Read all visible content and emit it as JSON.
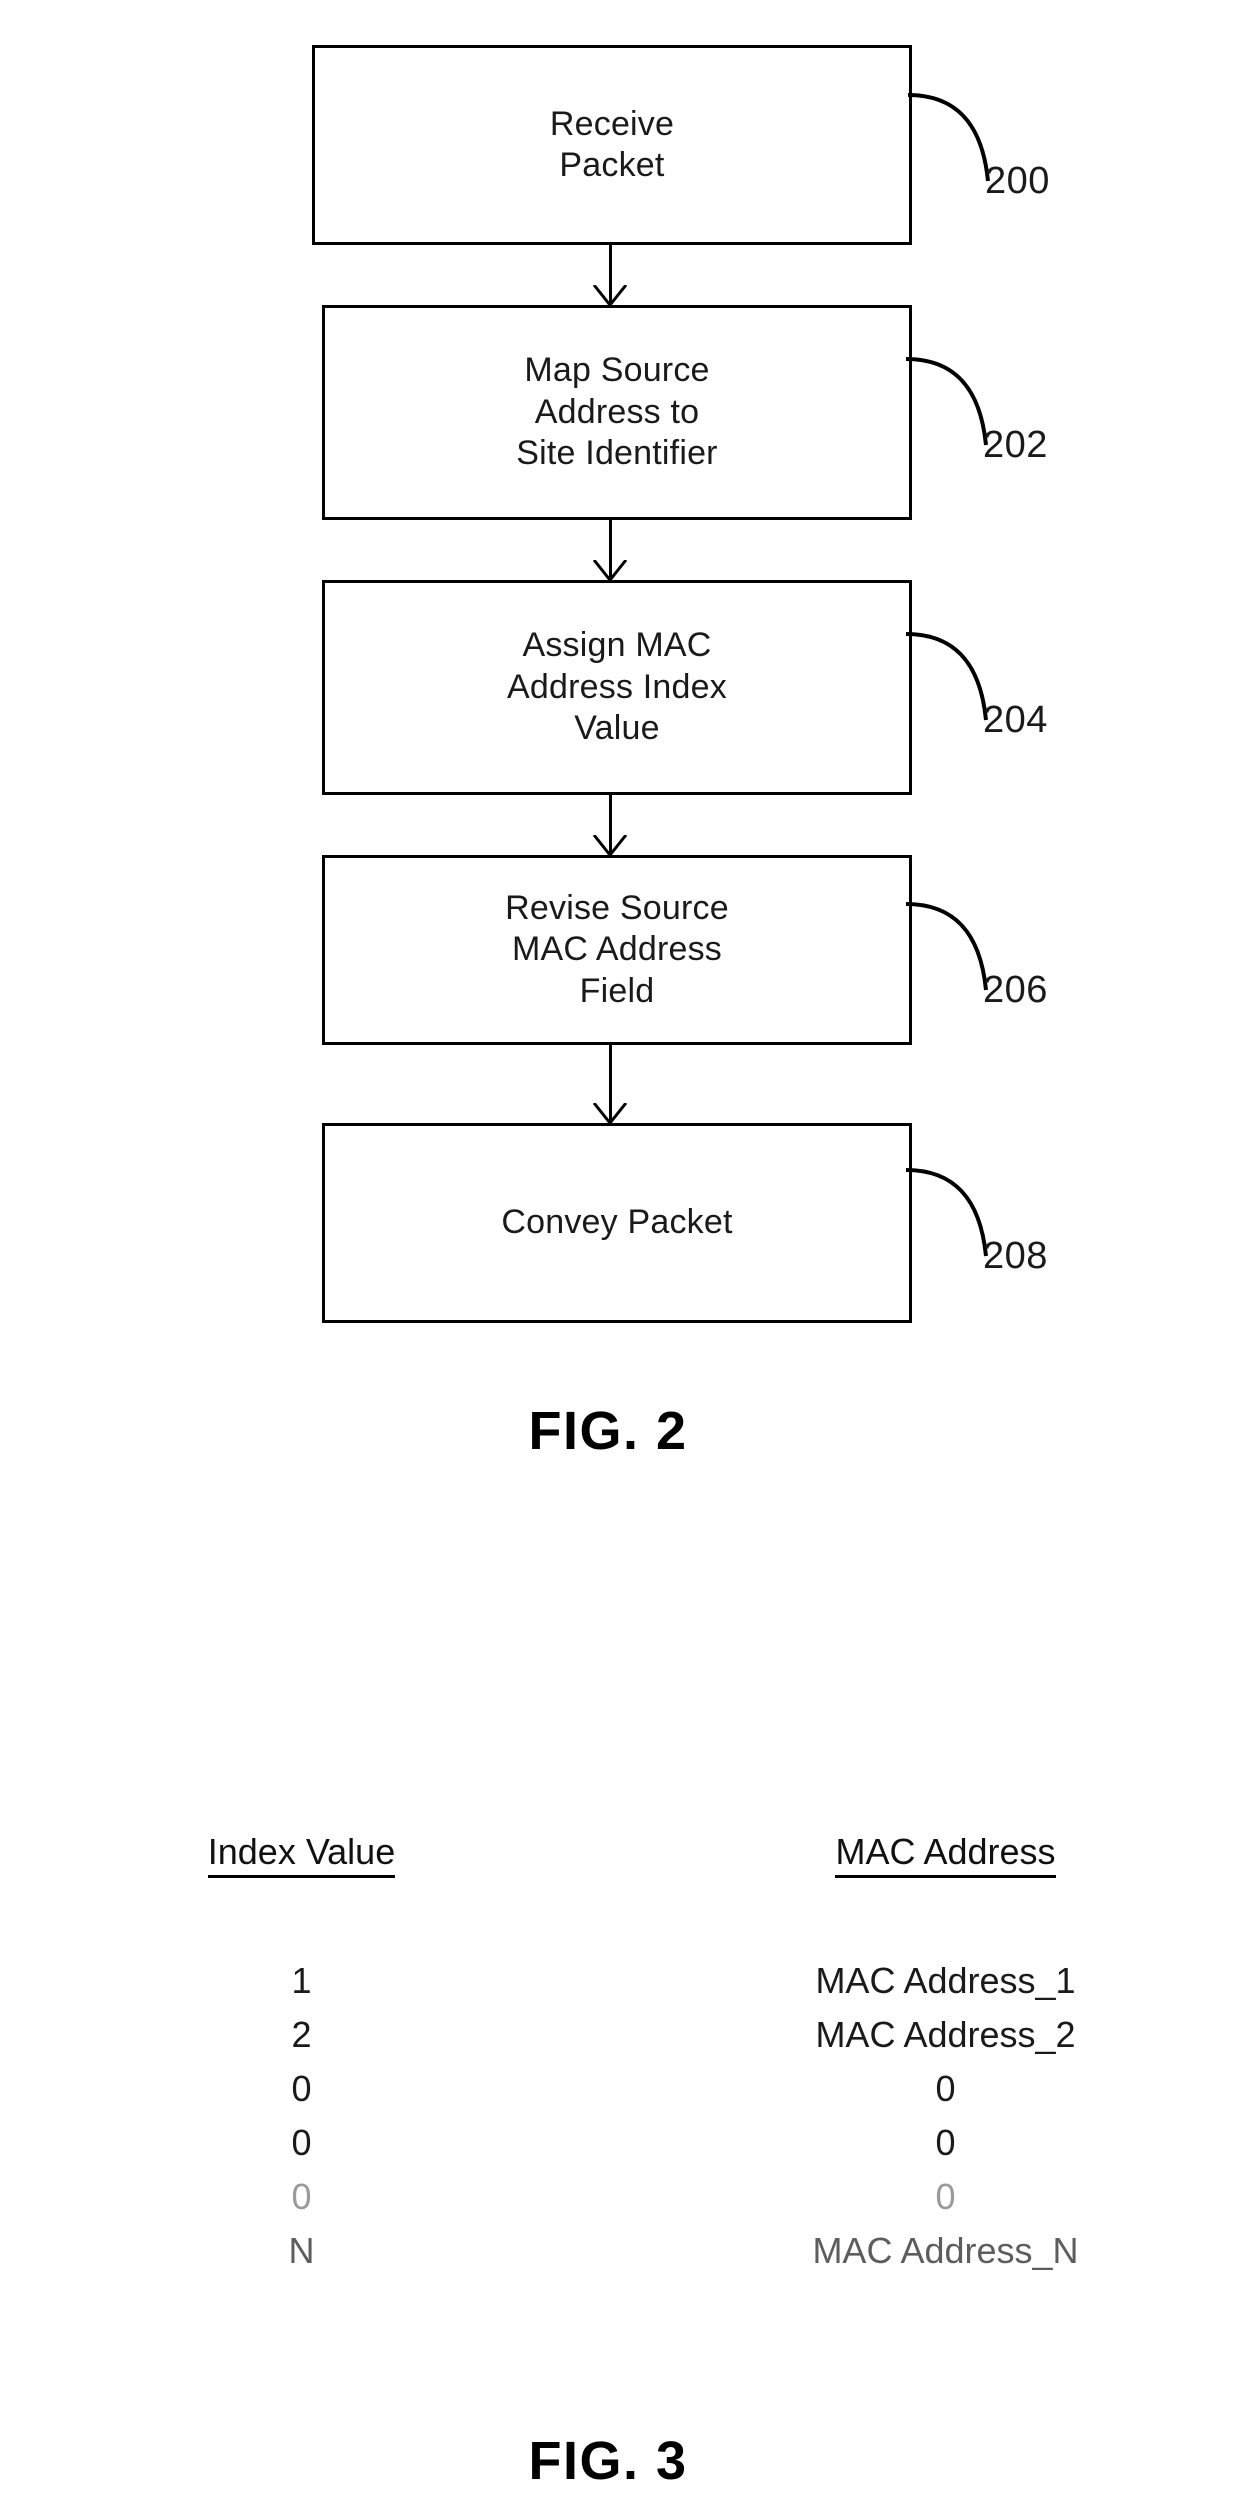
{
  "figure2": {
    "caption": "FIG. 2",
    "steps": [
      {
        "ref": "200",
        "text": "Receive\nPacket"
      },
      {
        "ref": "202",
        "text": "Map Source\nAddress to\nSite Identifier"
      },
      {
        "ref": "204",
        "text": "Assign MAC\nAddress Index\nValue"
      },
      {
        "ref": "206",
        "text": "Revise Source\nMAC Address\nField"
      },
      {
        "ref": "208",
        "text": "Convey Packet"
      }
    ]
  },
  "figure3": {
    "caption": "FIG. 3",
    "table": {
      "headers": [
        "Index Value",
        "MAC Address"
      ],
      "rows": [
        {
          "index": "1",
          "mac": "MAC Address_1",
          "style": "normal"
        },
        {
          "index": "2",
          "mac": "MAC Address_2",
          "style": "normal"
        },
        {
          "index": "0",
          "mac": "0",
          "style": "normal"
        },
        {
          "index": "0",
          "mac": "0",
          "style": "normal"
        },
        {
          "index": "0",
          "mac": "0",
          "style": "faded"
        },
        {
          "index": "N",
          "mac": "MAC Address_N",
          "style": "semi"
        }
      ]
    }
  }
}
